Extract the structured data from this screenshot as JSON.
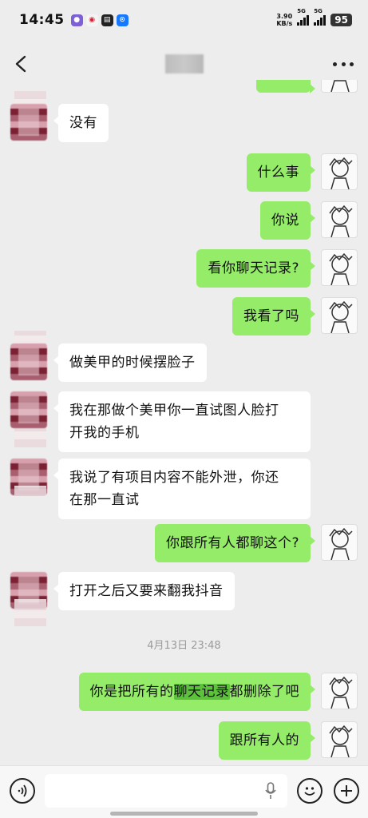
{
  "status_bar": {
    "time": "14:45",
    "net_speed_value": "3.90",
    "net_speed_unit": "KB/s",
    "signal_1": "5G",
    "signal_2": "5G",
    "battery": "95"
  },
  "messages": [
    {
      "side": "them",
      "text": "没有"
    },
    {
      "side": "me",
      "text": "什么事"
    },
    {
      "side": "me",
      "text": "你说"
    },
    {
      "side": "me",
      "text": "看你聊天记录?"
    },
    {
      "side": "me",
      "text": "我看了吗"
    },
    {
      "side": "them",
      "text": "做美甲的时候摆脸子"
    },
    {
      "side": "them",
      "text_line1": "我在那做个美甲你一直试图人脸打",
      "text_line2": "开我的手机"
    },
    {
      "side": "them",
      "text_line1": "我说了有项目内容不能外泄，你还",
      "text_line2": "在那一直试"
    },
    {
      "side": "me",
      "text": "你跟所有人都聊这个?"
    },
    {
      "side": "them",
      "text": "打开之后又要来翻我抖音"
    },
    {
      "side": "me",
      "text_before": "你是把所有的",
      "text_highlight": "聊天记录",
      "text_after": "都删除了吧"
    },
    {
      "side": "me",
      "text": "跟所有人的"
    }
  ],
  "timestamp": "4月13日 23:48",
  "colors": {
    "my_bubble": "#95ec69",
    "their_bubble": "#ffffff",
    "background": "#ededed",
    "highlight": "#5cc23b"
  },
  "input_bar": {
    "icons": [
      "voice-icon",
      "mic-icon",
      "emoji-icon",
      "plus-icon"
    ]
  }
}
